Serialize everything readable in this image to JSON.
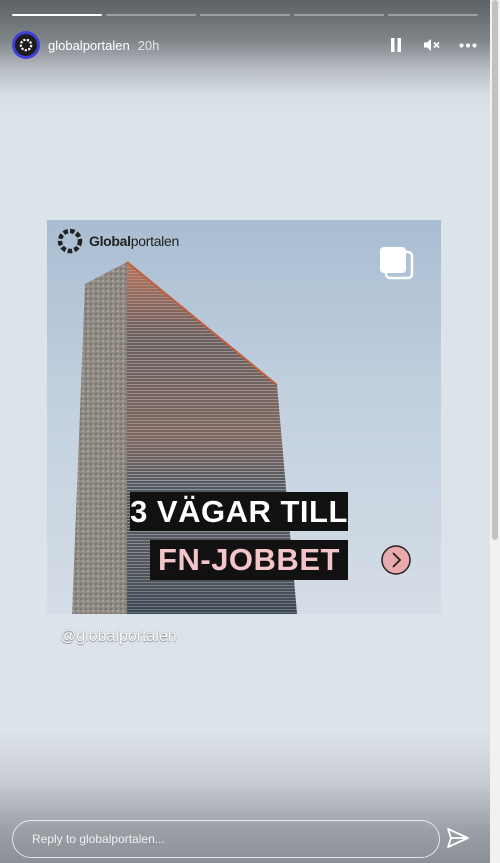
{
  "progress": {
    "segments": [
      1,
      0,
      0,
      0,
      0
    ]
  },
  "header": {
    "username": "globalportalen",
    "time": "20h"
  },
  "controls": [
    "pause-icon",
    "mute-icon",
    "more-icon"
  ],
  "post": {
    "brand_bold": "Global",
    "brand_light": "portalen",
    "headline_line1": "3 VÄGAR TILL",
    "headline_line2": "FN-JOBBET",
    "colors": {
      "headline_bg": "#111111",
      "headline1": "#ffffff",
      "headline2": "#f3c5c9",
      "next_button": "#e9a9ad"
    }
  },
  "mention": "@globalportalen",
  "reply": {
    "placeholder": "Reply to globalportalen..."
  }
}
